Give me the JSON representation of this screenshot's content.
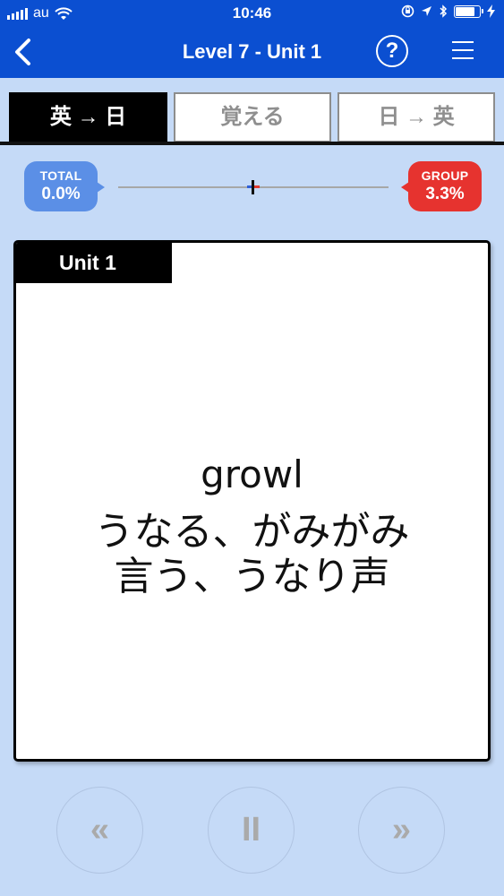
{
  "status_bar": {
    "carrier": "au",
    "time": "10:46",
    "battery_level": 0.8,
    "icons": [
      "signal-icon",
      "wifi-icon",
      "orientation-lock-icon",
      "location-icon",
      "bluetooth-icon",
      "battery-icon",
      "charging-icon"
    ]
  },
  "nav": {
    "title": "Level 7 - Unit 1",
    "back_icon": "chevron-left-icon",
    "help_label": "?",
    "menu_icon": "hamburger-menu-icon"
  },
  "tabs": [
    {
      "label": "英 → 日",
      "active": true
    },
    {
      "label": "覚える",
      "active": false
    },
    {
      "label": "日 → 英",
      "active": false
    }
  ],
  "progress": {
    "total_label": "TOTAL",
    "total_value": "0.0%",
    "group_label": "GROUP",
    "group_value": "3.3%",
    "colors": {
      "total": "#5b8fe6",
      "group": "#e6332f"
    }
  },
  "card": {
    "unit_label": "Unit 1",
    "word": "growl",
    "meaning_line1": "うなる、がみがみ",
    "meaning_line2": "言う、うなり声"
  },
  "controls": {
    "previous_label": "«",
    "pause_label": "II",
    "next_label": "»"
  },
  "colors": {
    "accent": "#0b4fd1",
    "background": "#c5daf7"
  }
}
